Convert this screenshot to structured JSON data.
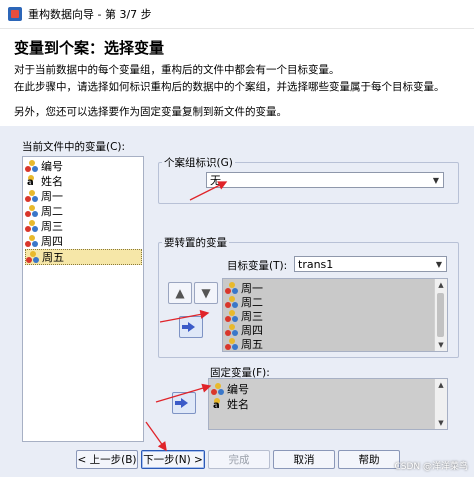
{
  "window": {
    "title": "重构数据向导 - 第 3/7 步"
  },
  "header": {
    "step_title": "变量到个案：选择变量",
    "desc_line1": "对于当前数据中的每个变量组，重构后的文件中都会有一个目标变量。",
    "desc_line2": "在此步骤中，请选择如何标识重构后的数据中的个案组，并选择哪些变量属于每个目标变量。",
    "desc_line3": "另外，您还可以选择要作为固定变量复制到新文件的变量。"
  },
  "current_vars": {
    "label": "当前文件中的变量(C):",
    "items": [
      {
        "name": "编号",
        "type": "scale"
      },
      {
        "name": "姓名",
        "type": "string"
      },
      {
        "name": "周一",
        "type": "scale"
      },
      {
        "name": "周二",
        "type": "scale"
      },
      {
        "name": "周三",
        "type": "scale"
      },
      {
        "name": "周四",
        "type": "scale"
      },
      {
        "name": "周五",
        "type": "scale",
        "selected": true
      }
    ]
  },
  "case_group": {
    "title": "个案组标识(G)",
    "value": "无"
  },
  "transpose": {
    "title": "要转置的变量",
    "target_label": "目标变量(T):",
    "target_value": "trans1",
    "items": [
      "周一",
      "周二",
      "周三",
      "周四",
      "周五"
    ]
  },
  "fixed": {
    "title": "固定变量(F):",
    "items": [
      {
        "name": "编号",
        "type": "scale"
      },
      {
        "name": "姓名",
        "type": "string"
      }
    ]
  },
  "buttons": {
    "back": "< 上一步(B)",
    "next": "下一步(N) >",
    "finish": "完成",
    "cancel": "取消",
    "help": "帮助"
  },
  "watermark": "CSDN @洋洋菜鸟",
  "colors": {
    "arrow_red": "#e0242a",
    "selection": "#f6e7a8"
  }
}
